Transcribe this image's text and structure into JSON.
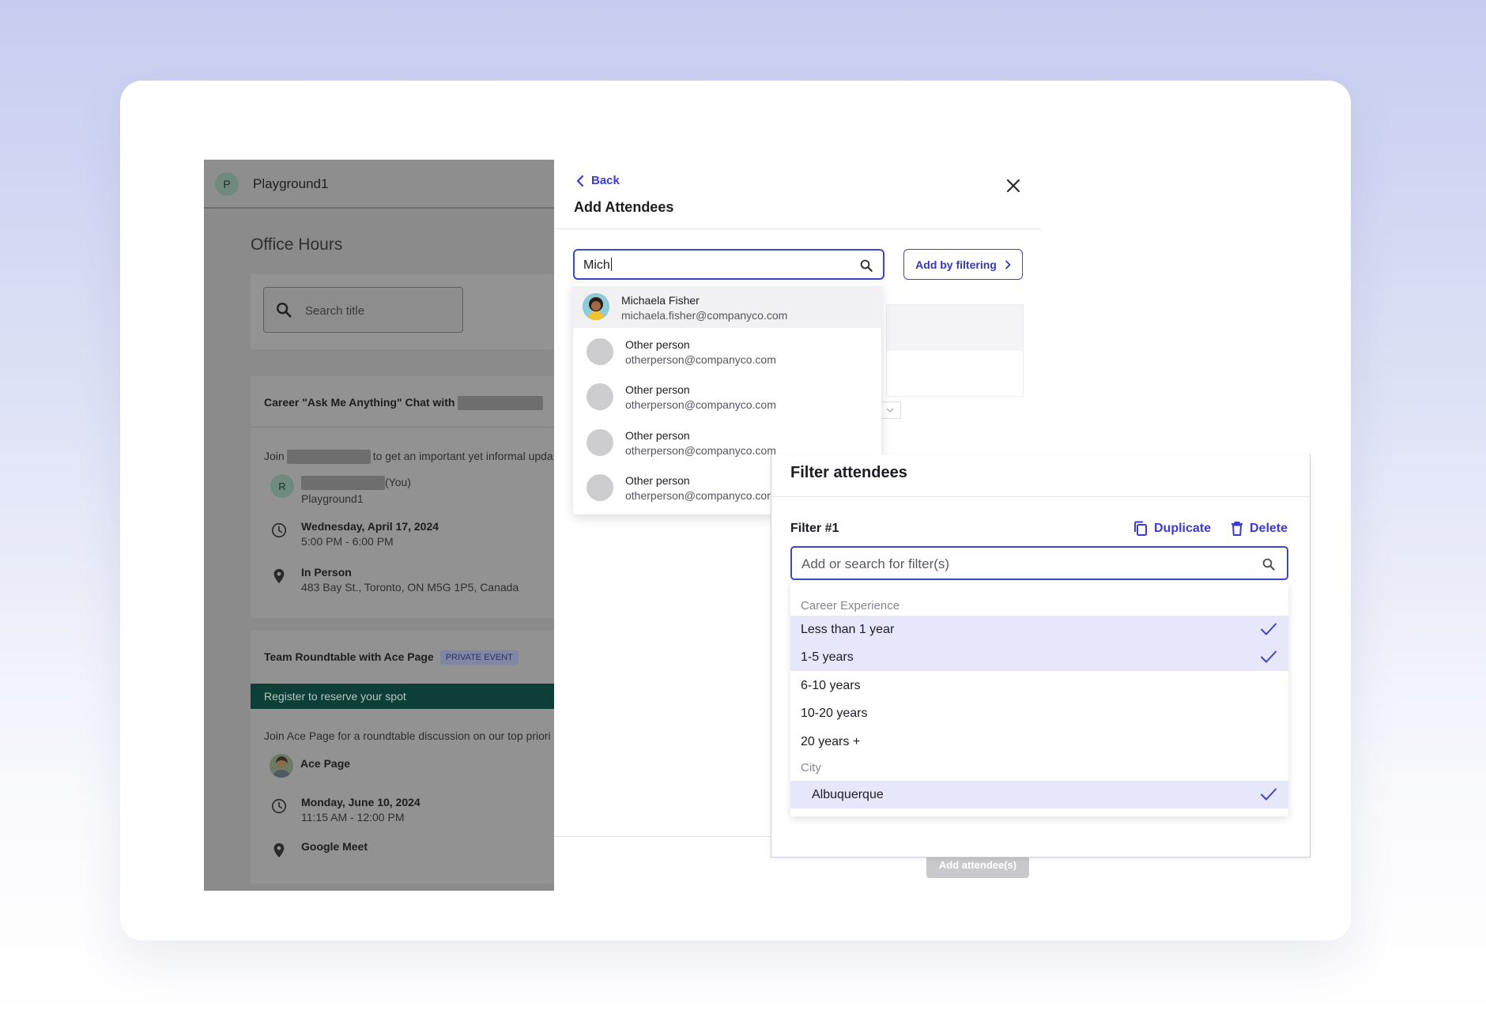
{
  "app": {
    "workspace_initial": "P",
    "workspace_name": "Playground1",
    "page_title": "Office Hours",
    "search_placeholder": "Search title",
    "events": [
      {
        "title": "Career \"Ask Me Anything\" Chat with",
        "desc_prefix": "Join",
        "desc_suffix": "to get an important yet informal upda",
        "host_initial": "R",
        "host_suffix": "(You)",
        "host_sub": "Playground1",
        "date": "Wednesday, April 17, 2024",
        "time": "5:00 PM - 6:00 PM",
        "location": "In Person",
        "address": "483 Bay St., Toronto, ON M5G 1P5, Canada"
      },
      {
        "title": "Team Roundtable with Ace Page",
        "badge": "PRIVATE EVENT",
        "register": "Register to reserve your spot",
        "desc": "Join Ace Page for a roundtable discussion on our top priori",
        "host": "Ace Page",
        "date": "Monday, June 10, 2024",
        "time": "11:15 AM - 12:00 PM",
        "location": "Google Meet"
      }
    ]
  },
  "attendees_panel": {
    "back_label": "Back",
    "title": "Add Attendees",
    "search_value": "Mich",
    "add_by_filtering": "Add by filtering",
    "submit_label": "Add attendee(s)",
    "suggestions": [
      {
        "name": "Michaela Fisher",
        "email": "michaela.fisher@companyco.com"
      },
      {
        "name": "Other person",
        "email": "otherperson@companyco.com"
      },
      {
        "name": "Other person",
        "email": "otherperson@companyco.com"
      },
      {
        "name": "Other person",
        "email": "otherperson@companyco.com"
      },
      {
        "name": "Other person",
        "email": "otherperson@companyco.com"
      }
    ]
  },
  "filter_panel": {
    "title": "Filter attendees",
    "filter_label": "Filter #1",
    "duplicate": "Duplicate",
    "delete": "Delete",
    "search_placeholder": "Add or search for filter(s)",
    "groups": [
      {
        "name": "Career Experience",
        "options": [
          {
            "label": "Less than 1 year",
            "selected": true
          },
          {
            "label": "1-5 years",
            "selected": true
          },
          {
            "label": "6-10 years",
            "selected": false
          },
          {
            "label": "10-20 years",
            "selected": false
          },
          {
            "label": "20 years +",
            "selected": false
          }
        ]
      },
      {
        "name": "City",
        "options": [
          {
            "label": "Albuquerque",
            "selected": true
          }
        ]
      }
    ]
  },
  "colors": {
    "accent": "#3d45c8",
    "selected_bg": "#e6e7fb",
    "register_bar": "#0d3f36"
  }
}
